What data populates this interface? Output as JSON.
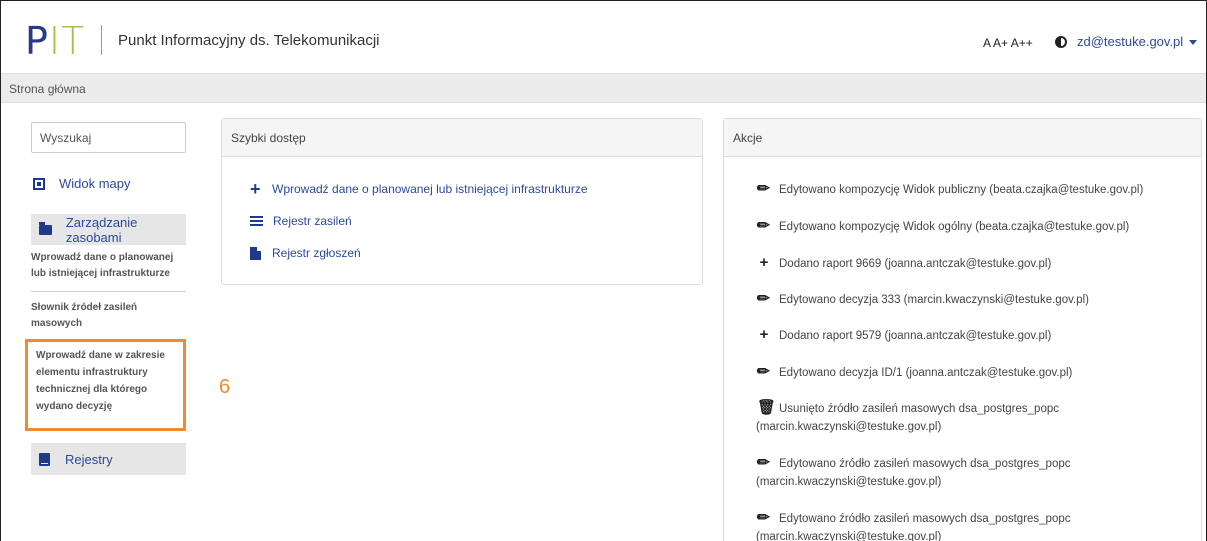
{
  "header": {
    "logo_p": "P",
    "logo_it": "IT",
    "app_title": "Punkt Informacyjny ds. Telekomunikacji",
    "font_sizes": "A A+ A++",
    "user_email": "zd@testuke.gov.pl"
  },
  "breadcrumb": "Strona główna",
  "sidebar": {
    "search_placeholder": "Wyszukaj",
    "map_view": "Widok mapy",
    "resources": "Zarządzanie zasobami",
    "sub_items": [
      "Wprowadź dane o planowanej lub istniejącej infrastrukturze",
      "Słownik źródeł zasileń masowych",
      "Wprowadź dane w zakresie elementu infrastruktury technicznej dla którego wydano decyzję"
    ],
    "registers": "Rejestry"
  },
  "annotation_number": "6",
  "quick_access": {
    "title": "Szybki dostęp",
    "items": [
      "Wprowadź dane o planowanej lub istniejącej infrastrukturze",
      "Rejestr zasileń",
      "Rejestr zgłoszeń"
    ]
  },
  "actions": {
    "title": "Akcje",
    "items": [
      {
        "icon": "pencil-icon",
        "text": "Edytowano kompozycję Widok publiczny (beata.czajka@testuke.gov.pl)"
      },
      {
        "icon": "pencil-icon",
        "text": "Edytowano kompozycję Widok ogólny (beata.czajka@testuke.gov.pl)"
      },
      {
        "icon": "plus-icon",
        "text": "Dodano raport 9669 (joanna.antczak@testuke.gov.pl)"
      },
      {
        "icon": "pencil-icon",
        "text": "Edytowano decyzja 333 (marcin.kwaczynski@testuke.gov.pl)"
      },
      {
        "icon": "plus-icon",
        "text": "Dodano raport 9579 (joanna.antczak@testuke.gov.pl)"
      },
      {
        "icon": "pencil-icon",
        "text": "Edytowano decyzja ID/1 (joanna.antczak@testuke.gov.pl)"
      },
      {
        "icon": "trash-icon",
        "text": "Usunięto źródło zasileń masowych dsa_postgres_popc",
        "cont": "(marcin.kwaczynski@testuke.gov.pl)"
      },
      {
        "icon": "pencil-icon",
        "text": "Edytowano źródło zasileń masowych dsa_postgres_popc",
        "cont": "(marcin.kwaczynski@testuke.gov.pl)"
      },
      {
        "icon": "pencil-icon",
        "text": "Edytowano źródło zasileń masowych dsa_postgres_popc",
        "cont": "(marcin.kwaczynski@testuke.gov.pl)"
      }
    ]
  },
  "colors": {
    "brand_blue": "#2b3a87",
    "brand_green": "#a6c24a",
    "link_blue": "#2b4a9a",
    "highlight_orange": "#f08a30"
  }
}
